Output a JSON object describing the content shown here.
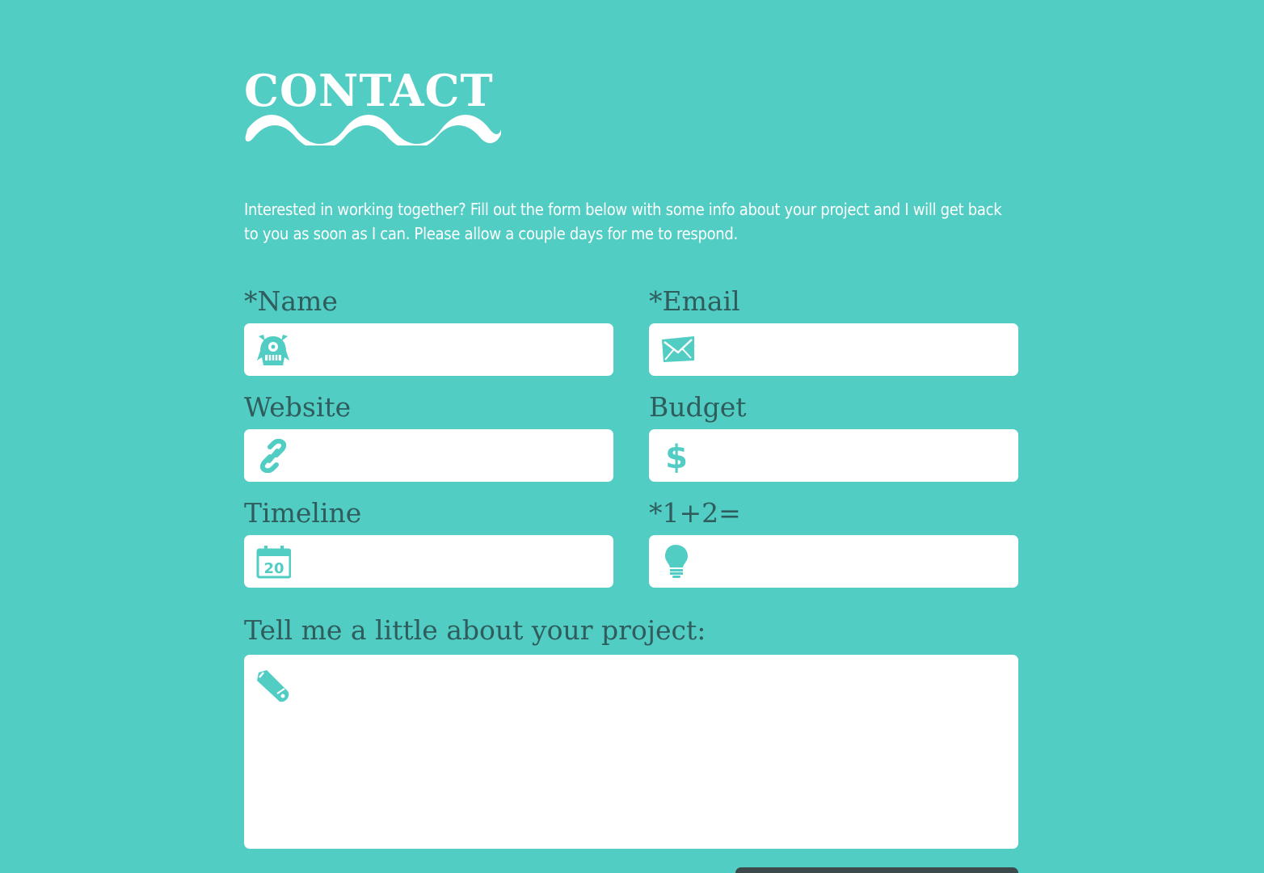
{
  "page": {
    "heading": "CONTACT",
    "intro": "Interested in working together? Fill out the form below with some info about your project and I will get back to you as soon as I can. Please allow a couple days for me to respond."
  },
  "colors": {
    "background": "#51cdc4",
    "label": "#2f5c5c",
    "input_bg": "#ffffff",
    "icon": "#51cdc4",
    "button": "#3d4a4c"
  },
  "form": {
    "name": {
      "label": "*Name",
      "value": "",
      "icon": "monster-icon"
    },
    "email": {
      "label": "*Email",
      "value": "",
      "icon": "envelope-icon"
    },
    "website": {
      "label": "Website",
      "value": "",
      "icon": "link-icon"
    },
    "budget": {
      "label": "Budget",
      "value": "",
      "icon": "dollar-icon"
    },
    "timeline": {
      "label": "Timeline",
      "value": "",
      "icon": "calendar-icon"
    },
    "captcha": {
      "label": "*1+2=",
      "value": "",
      "icon": "lightbulb-icon"
    },
    "message": {
      "label": "Tell me a little about your project:",
      "value": "",
      "icon": "pen-icon"
    },
    "calendar_icon_text": "20"
  }
}
